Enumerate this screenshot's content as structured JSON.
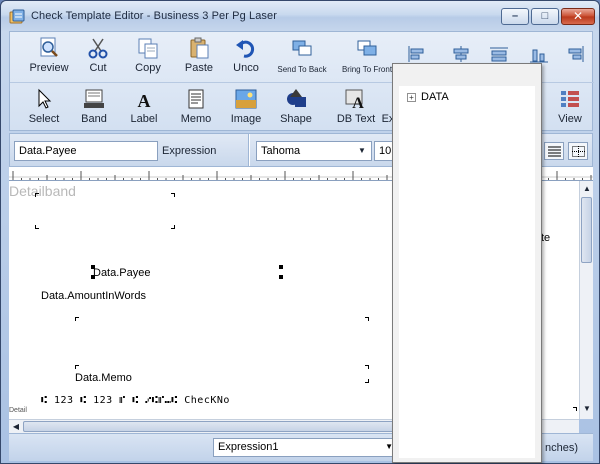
{
  "window": {
    "title": "Check Template Editor - Business 3 Per Pg Laser",
    "minimize": "–",
    "maximize": "□",
    "close": "✕"
  },
  "toolbar": {
    "row1": [
      {
        "label": "Preview",
        "icon": "preview-icon"
      },
      {
        "label": "Cut",
        "icon": "scissors-icon"
      },
      {
        "label": "Copy",
        "icon": "copy-icon"
      },
      {
        "label": "Paste",
        "icon": "paste-icon"
      },
      {
        "label": "Unco",
        "icon": "undo-icon"
      },
      {
        "label": "Send To Back",
        "icon": "send-to-back-icon"
      },
      {
        "label": "Bring To Front",
        "icon": "bring-to-front-icon"
      }
    ],
    "row2": [
      {
        "label": "Select",
        "icon": "pointer-icon"
      },
      {
        "label": "Band",
        "icon": "band-icon"
      },
      {
        "label": "Label",
        "icon": "label-icon"
      },
      {
        "label": "Memo",
        "icon": "memo-icon"
      },
      {
        "label": "Image",
        "icon": "image-icon"
      },
      {
        "label": "Shape",
        "icon": "shape-icon"
      },
      {
        "label": "DB Text",
        "icon": "db-text-icon"
      },
      {
        "label": "Ex",
        "icon": "expression-icon"
      },
      {
        "label": "View",
        "icon": "view-icon"
      }
    ]
  },
  "properties": {
    "field_value": "Data.Payee",
    "field_type_label": "Expression",
    "font_name": "Tahoma",
    "font_size": "10"
  },
  "canvas": {
    "band_name": "Detailband",
    "detail_tag": "Detail",
    "items": {
      "payee": "Data.Payee",
      "amount_words": "Data.AmountInWords",
      "memo": "Data.Memo",
      "micr": "⑆ 123 ⑆ 123 ⑈ ⑆ ⑇⑆⑈⑉⑆ ChecKNo",
      "partial_right": "te"
    }
  },
  "tree": {
    "root_label": "DATA",
    "expander": "+"
  },
  "statusbar": {
    "expression_selected": "Expression1",
    "units_partial": "nches)"
  }
}
